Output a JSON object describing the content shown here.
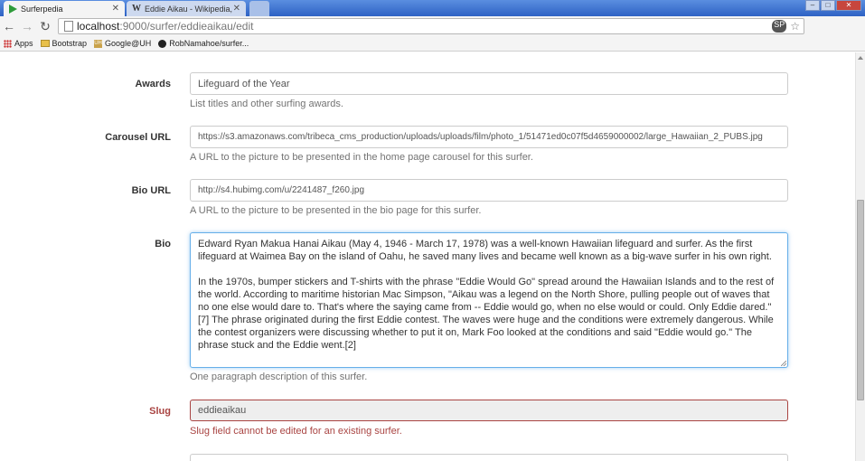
{
  "browser": {
    "tabs": [
      {
        "title": "Surferpedia",
        "active": true
      },
      {
        "title": "Eddie Aikau - Wikipedia, t",
        "active": false
      }
    ],
    "url_host": "localhost",
    "url_path": ":9000/surfer/eddieaikau/edit",
    "bookmarks": [
      "Apps",
      "Bootstrap",
      "Google@UH",
      "RobNamahoe/surfer..."
    ]
  },
  "form": {
    "awards": {
      "label": "Awards",
      "value": "Lifeguard of the Year",
      "help": "List titles and other surfing awards."
    },
    "carousel_url": {
      "label": "Carousel URL",
      "value": "https://s3.amazonaws.com/tribeca_cms_production/uploads/uploads/film/photo_1/51471ed0c07f5d4659000002/large_Hawaiian_2_PUBS.jpg",
      "help": "A URL to the picture to be presented in the home page carousel for this surfer."
    },
    "bio_url": {
      "label": "Bio URL",
      "value": "http://s4.hubimg.com/u/2241487_f260.jpg",
      "help": "A URL to the picture to be presented in the bio page for this surfer."
    },
    "bio": {
      "label": "Bio",
      "paragraph1": "Edward Ryan Makua Hanai Aikau (May 4, 1946 - March 17, 1978) was a well-known Hawaiian lifeguard and surfer. As the first lifeguard at Waimea Bay on the island of Oahu, he saved many lives and became well known as a big-wave surfer in his own right.",
      "paragraph2": "In the 1970s, bumper stickers and T-shirts with the phrase \"Eddie Would Go\" spread around the Hawaiian Islands and to the rest of the world. According to maritime historian Mac Simpson, \"Aikau was a legend on the North Shore, pulling people out of waves that no one else would dare to. That's where the saying came from -- Eddie would go, when no else would or could. Only Eddie dared.\"[7] The phrase originated during the first Eddie contest. The waves were huge and the conditions were extremely dangerous. While the contest organizers were discussing whether to put it on, Mark Foo looked at the conditions and said \"Eddie would go.\" The phrase stuck and the Eddie went.[2]",
      "help": "One paragraph description of this surfer."
    },
    "slug": {
      "label": "Slug",
      "value": "eddieaikau",
      "help": "Slug field cannot be edited for an existing surfer."
    }
  },
  "colors": {
    "error": "#a94442",
    "focus": "#66afe9",
    "tab_strip": "#3b6fd1"
  }
}
